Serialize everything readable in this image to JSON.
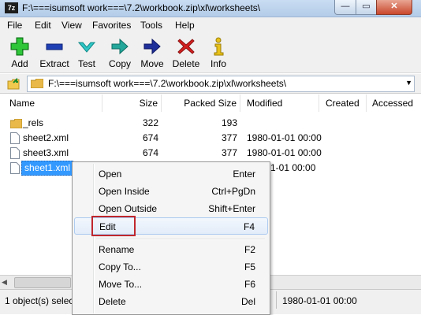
{
  "app_icon_text": "7z",
  "window": {
    "title": "F:\\===isumsoft work===\\7.2\\workbook.zip\\xl\\worksheets\\",
    "minimize_glyph": "—",
    "maximize_glyph": "▭",
    "close_glyph": "✕"
  },
  "menu": [
    "File",
    "Edit",
    "View",
    "Favorites",
    "Tools",
    "Help"
  ],
  "toolbar": {
    "add": "Add",
    "extract": "Extract",
    "test": "Test",
    "copy": "Copy",
    "move": "Move",
    "delete": "Delete",
    "info": "Info"
  },
  "address": {
    "path": "F:\\===isumsoft work===\\7.2\\workbook.zip\\xl\\worksheets\\"
  },
  "columns": {
    "name": "Name",
    "size": "Size",
    "packed": "Packed Size",
    "modified": "Modified",
    "created": "Created",
    "accessed": "Accessed"
  },
  "files": [
    {
      "name": "_rels",
      "size": "322",
      "packed": "193",
      "modified": "",
      "type": "folder"
    },
    {
      "name": "sheet2.xml",
      "size": "674",
      "packed": "377",
      "modified": "1980-01-01 00:00",
      "type": "file"
    },
    {
      "name": "sheet3.xml",
      "size": "674",
      "packed": "377",
      "modified": "1980-01-01 00:00",
      "type": "file"
    },
    {
      "name": "sheet1.xml",
      "size": "",
      "packed": "",
      "modified": "1-01 00:00",
      "type": "file",
      "selected": true
    }
  ],
  "context_menu": {
    "open": {
      "label": "Open",
      "shortcut": "Enter"
    },
    "open_inside": {
      "label": "Open Inside",
      "shortcut": "Ctrl+PgDn"
    },
    "open_outside": {
      "label": "Open Outside",
      "shortcut": "Shift+Enter"
    },
    "edit": {
      "label": "Edit",
      "shortcut": "F4"
    },
    "rename": {
      "label": "Rename",
      "shortcut": "F2"
    },
    "copy_to": {
      "label": "Copy To...",
      "shortcut": "F5"
    },
    "move_to": {
      "label": "Move To...",
      "shortcut": "F6"
    },
    "delete": {
      "label": "Delete",
      "shortcut": "Del"
    }
  },
  "status": {
    "selection": "1 object(s) selec",
    "modified": "1980-01-01 00:00"
  },
  "colors": {
    "selection": "#3399ff",
    "highlight_box": "#c0272d",
    "add_icon": "#1fae2a",
    "delete_icon": "#d42020",
    "info_icon": "#e8c21a"
  }
}
